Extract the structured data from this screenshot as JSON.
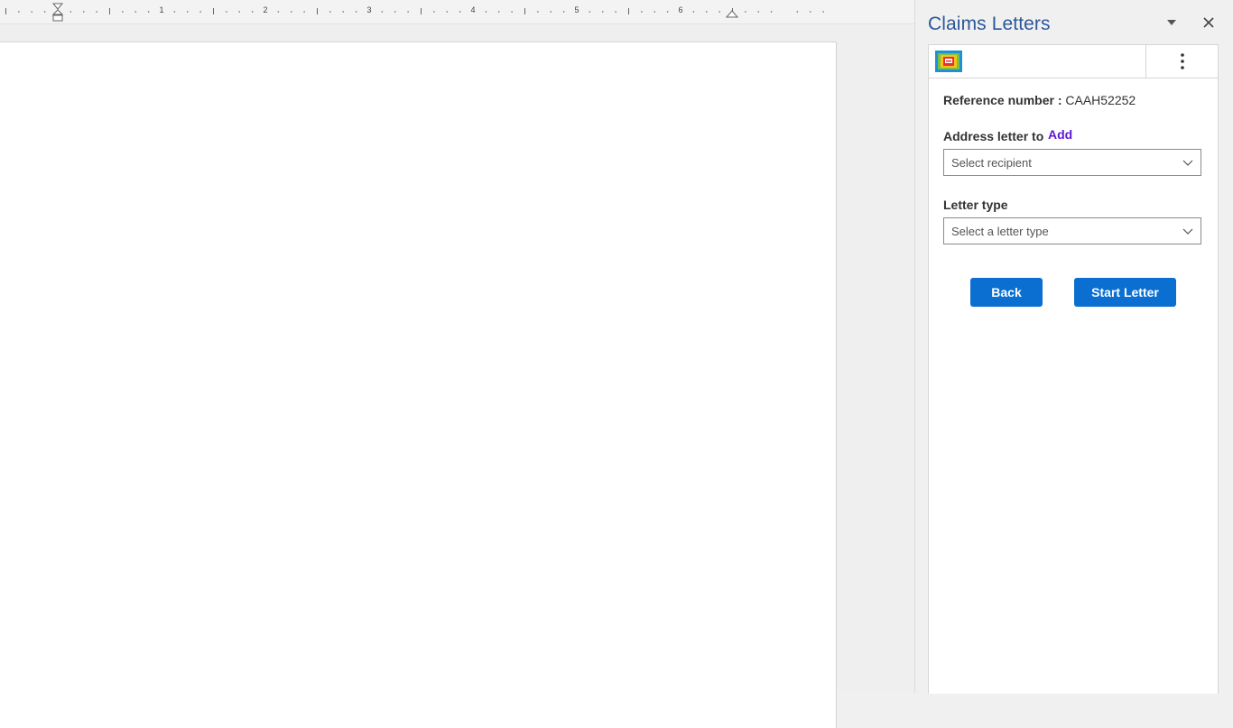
{
  "ruler": {
    "numbers": [
      "1",
      "2",
      "3",
      "4",
      "5",
      "6"
    ]
  },
  "pane": {
    "title": "Claims Letters",
    "options_icon": "caret-down-icon",
    "close_icon": "close-icon"
  },
  "addin": {
    "logo_icon": "addin-logo-icon",
    "menu_icon": "more-vertical-icon",
    "reference_label": "Reference number :",
    "reference_value": "CAAH52252",
    "address_label": "Address letter to",
    "add_link": "Add",
    "recipient_placeholder": "Select recipient",
    "letter_type_label": "Letter type",
    "letter_type_placeholder": "Select a letter type",
    "back_button": "Back",
    "start_button": "Start Letter"
  },
  "colors": {
    "pane_title": "#2b579a",
    "add_link": "#5b17d6",
    "button": "#0a6fd1"
  }
}
